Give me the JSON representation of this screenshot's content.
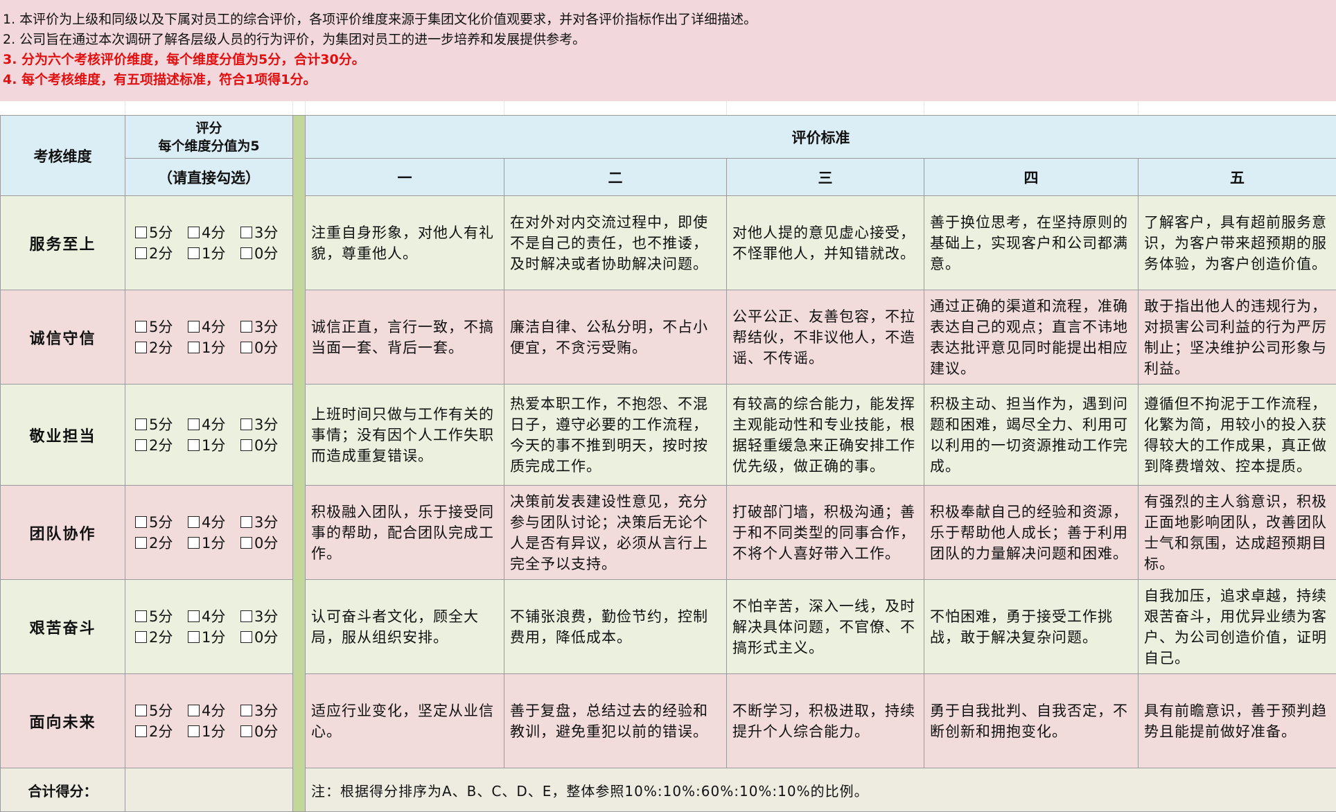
{
  "notes": [
    {
      "text": "1. 本评价为上级和同级以及下属对员工的综合评价，各项评价维度来源于集团文化价值观要求，并对各评价指标作出了详细描述。",
      "red": false
    },
    {
      "text": "2. 公司旨在通过本次调研了解各层级人员的行为评价，为集团对员工的进一步培养和发展提供参考。",
      "red": false
    },
    {
      "text": "3. 分为六个考核评价维度，每个维度分值为5分，合计30分。",
      "red": true
    },
    {
      "text": "4. 每个考核维度，有五项描述标准，符合1项得1分。",
      "red": true
    }
  ],
  "header": {
    "dimension": "考核维度",
    "score_title": "评分",
    "score_sub": "每个维度分值为5",
    "score_hint": "（请直接勾选）",
    "criteria": "评价标准",
    "columns": [
      "一",
      "二",
      "三",
      "四",
      "五"
    ]
  },
  "score_options": [
    "5分",
    "4分",
    "3分",
    "2分",
    "1分",
    "0分"
  ],
  "rows": [
    {
      "name": "服务至上",
      "color": "#ebf1de",
      "criteria": [
        "注重自身形象，对他人有礼貌，尊重他人。",
        "在对外对内交流过程中，即使不是自己的责任，也不推诿，及时解决或者协助解决问题。",
        "对他人提的意见虚心接受，不怪罪他人，并知错就改。",
        "善于换位思考，在坚持原则的基础上，实现客户和公司都满意。",
        "了解客户，具有超前服务意识，为客户带来超预期的服务体验，为客户创造价值。"
      ]
    },
    {
      "name": "诚信守信",
      "color": "#f2dcdb",
      "criteria": [
        "诚信正直，言行一致，不搞当面一套、背后一套。",
        "廉洁自律、公私分明，不占小便宜，不贪污受贿。",
        "公平公正、友善包容，不拉帮结伙，不非议他人，不造谣、不传谣。",
        "通过正确的渠道和流程，准确表达自己的观点；直言不讳地表达批评意见同时能提出相应建议。",
        "敢于指出他人的违规行为，对损害公司利益的行为严厉制止；坚决维护公司形象与利益。"
      ]
    },
    {
      "name": "敬业担当",
      "color": "#ebf1de",
      "criteria": [
        "上班时间只做与工作有关的事情；没有因个人工作失职而造成重复错误。",
        "热爱本职工作，不抱怨、不混日子，遵守必要的工作流程，今天的事不推到明天，按时按质完成工作。",
        "有较高的综合能力，能发挥主观能动性和专业技能，根据轻重缓急来正确安排工作优先级，做正确的事。",
        "积极主动、担当作为，遇到问题和困难，竭尽全力、利用可以利用的一切资源推动工作完成。",
        "遵循但不拘泥于工作流程，化繁为简，用较小的投入获得较大的工作成果，真正做到降费增效、控本提质。"
      ]
    },
    {
      "name": "团队协作",
      "color": "#f2dcdb",
      "criteria": [
        "积极融入团队，乐于接受同事的帮助，配合团队完成工作。",
        "决策前发表建设性意见，充分参与团队讨论；决策后无论个人是否有异议，必须从言行上完全予以支持。",
        "打破部门墙，积极沟通；善于和不同类型的同事合作，不将个人喜好带入工作。",
        "积极奉献自己的经验和资源，乐于帮助他人成长；善于利用团队的力量解决问题和困难。",
        "有强烈的主人翁意识，积极正面地影响团队，改善团队士气和氛围，达成超预期目标。"
      ]
    },
    {
      "name": "艰苦奋斗",
      "color": "#ebf1de",
      "criteria": [
        "认可奋斗者文化，顾全大局，服从组织安排。",
        "不铺张浪费，勤俭节约，控制费用，降低成本。",
        "不怕辛苦，深入一线，及时解决具体问题，不官僚、不搞形式主义。",
        "不怕困难，勇于接受工作挑战，敢于解决复杂问题。",
        "自我加压，追求卓越，持续艰苦奋斗，用优异业绩为客户、为公司创造价值，证明自己。"
      ]
    },
    {
      "name": "面向未来",
      "color": "#f2dcdb",
      "criteria": [
        "适应行业变化，坚定从业信心。",
        "善于复盘，总结过去的经验和教训，避免重犯以前的错误。",
        "不断学习，积极进取，持续提升个人综合能力。",
        "勇于自我批判、自我否定，不断创新和拥抱变化。",
        "具有前瞻意识，善于预判趋势且能提前做好准备。"
      ]
    }
  ],
  "footer": {
    "total_label": "合计得分：",
    "total_value": "",
    "note": "注：根据得分排序为A、B、C、D、E，整体参照10%:10%:60%:10%:10%的比例。"
  },
  "colors": {
    "note_bg": "#f2d8dc",
    "note_red": "#e01010",
    "header_bg": "#dbeef5",
    "green_row": "#ebf1de",
    "pink_row": "#f2dcdb",
    "separator": "#c3d79b",
    "footer_bg": "#eeece1"
  }
}
